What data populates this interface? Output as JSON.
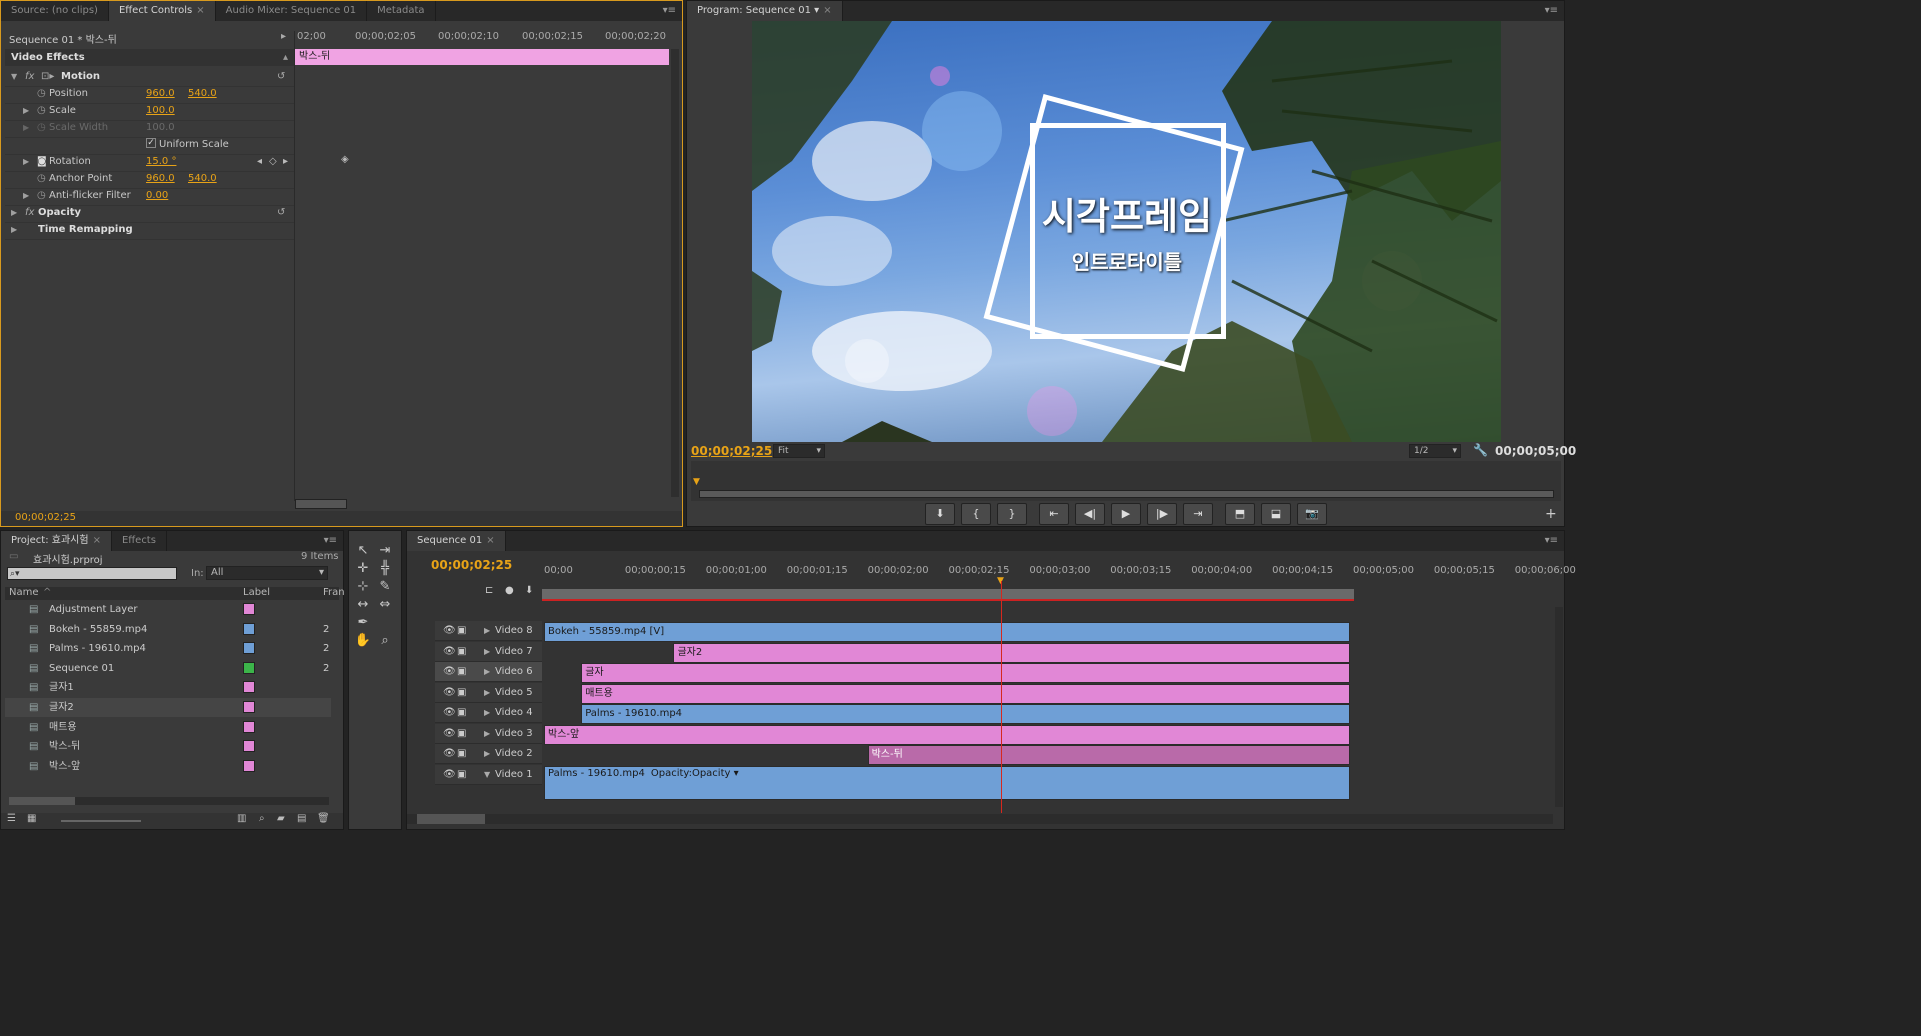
{
  "colors": {
    "timecode": "#e8a317",
    "pink_label": "#e187d6",
    "blue_label": "#6f9fd6",
    "green_label": "#3cb54a",
    "playhead": "#d6281e"
  },
  "source_panel": {
    "tabs": [
      "Source: (no clips)",
      "Effect Controls",
      "Audio Mixer: Sequence 01",
      "Metadata"
    ],
    "sequence_label": "Sequence 01 * 박스-뒤",
    "clip_label": "박스-뒤",
    "ruler": [
      "02;00",
      "00;00;02;05",
      "00;00;02;10",
      "00;00;02;15",
      "00;00;02;20"
    ],
    "section": "Video Effects",
    "effects": [
      {
        "name": "Motion",
        "level": 0,
        "expanded": true
      },
      {
        "name": "Position",
        "v1": "960.0",
        "v2": "540.0"
      },
      {
        "name": "Scale",
        "v1": "100.0"
      },
      {
        "name": "Scale Width",
        "v1": "100.0",
        "disabled": true
      },
      {
        "name": "Uniform Scale",
        "checked": true
      },
      {
        "name": "Rotation",
        "v1": "15.0 °"
      },
      {
        "name": "Anchor Point",
        "v1": "960.0",
        "v2": "540.0"
      },
      {
        "name": "Anti-flicker Filter",
        "v1": "0.00"
      },
      {
        "name": "Opacity",
        "level": 0
      },
      {
        "name": "Time Remapping",
        "level": 0
      }
    ],
    "timecode": "00;00;02;25"
  },
  "program": {
    "tab": "Program: Sequence 01",
    "title_text": "시각프레임",
    "subtitle_text": "인트로타이틀",
    "timecode": "00;00;02;25",
    "fit": "Fit",
    "quality": "1/2",
    "duration": "00;00;05;00"
  },
  "project": {
    "tabs": [
      "Project: 효과시험",
      "Effects"
    ],
    "file": "효과시험.prproj",
    "count": "9 Items",
    "in_label": "In:",
    "in_value": "All",
    "columns": [
      "Name",
      "Label",
      "Fran"
    ],
    "items": [
      {
        "name": "Adjustment Layer",
        "color": "#e187d6",
        "fr": ""
      },
      {
        "name": "Bokeh - 55859.mp4",
        "color": "#6f9fd6",
        "fr": "2"
      },
      {
        "name": "Palms - 19610.mp4",
        "color": "#6f9fd6",
        "fr": "2"
      },
      {
        "name": "Sequence 01",
        "color": "#3cb54a",
        "fr": "2"
      },
      {
        "name": "글자1",
        "color": "#e187d6",
        "fr": ""
      },
      {
        "name": "글자2",
        "color": "#e187d6",
        "fr": ""
      },
      {
        "name": "매트용",
        "color": "#e187d6",
        "fr": ""
      },
      {
        "name": "박스-뒤",
        "color": "#e187d6",
        "fr": ""
      },
      {
        "name": "박스-앞",
        "color": "#e187d6",
        "fr": ""
      }
    ]
  },
  "timeline": {
    "tab": "Sequence 01",
    "timecode": "00;00;02;25",
    "ruler": [
      "00;00",
      "00;00;00;15",
      "00;00;01;00",
      "00;00;01;15",
      "00;00;02;00",
      "00;00;02;15",
      "00;00;03;00",
      "00;00;03;15",
      "00;00;04;00",
      "00;00;04;15",
      "00;00;05;00",
      "00;00;05;15",
      "00;00;06;00"
    ],
    "tracks": [
      {
        "name": "Video 8",
        "clip": "Bokeh - 55859.mp4 [V]",
        "kind": "blue",
        "start": 0
      },
      {
        "name": "Video 7",
        "clip": "글자2",
        "kind": "pink",
        "start": 0.8
      },
      {
        "name": "Video 6",
        "clip": "글자",
        "kind": "pink",
        "start": 0.23
      },
      {
        "name": "Video 5",
        "clip": "매트용",
        "kind": "pink",
        "start": 0.23
      },
      {
        "name": "Video 4",
        "clip": "Palms - 19610.mp4",
        "kind": "blue",
        "start": 0.23
      },
      {
        "name": "Video 3",
        "clip": "박스-앞",
        "kind": "pink",
        "start": 0
      },
      {
        "name": "Video 2",
        "clip": "박스-뒤",
        "kind": "dpink",
        "start": 2.0
      },
      {
        "name": "Video 1",
        "clip": "Palms - 19610.mp4",
        "kind": "blue",
        "start": 0,
        "extra": "Opacity:Opacity ▾"
      }
    ]
  }
}
